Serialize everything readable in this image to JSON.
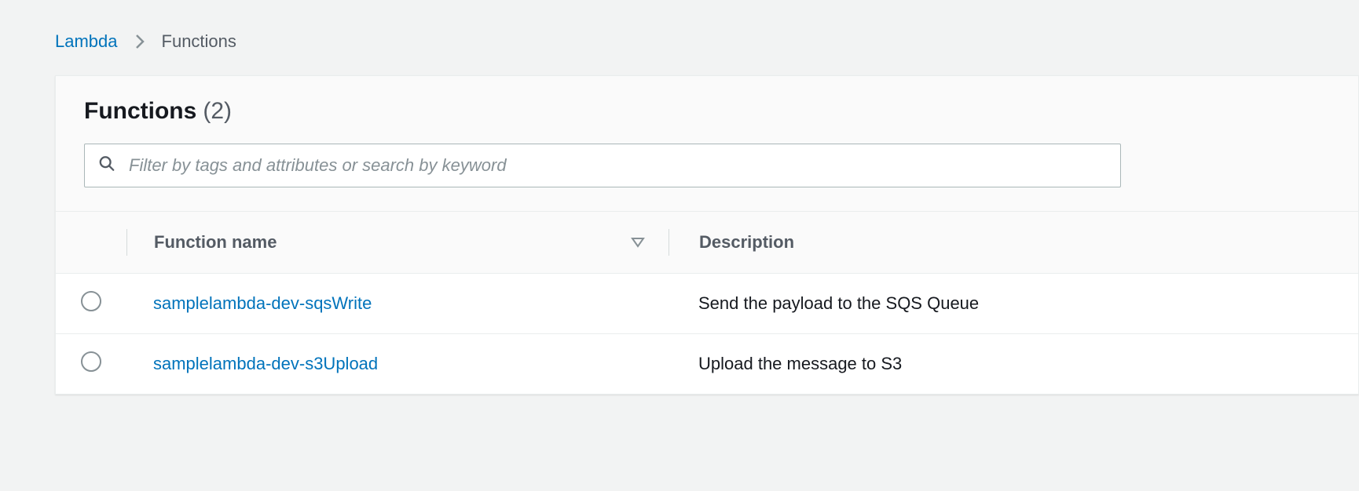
{
  "breadcrumb": {
    "root": "Lambda",
    "current": "Functions"
  },
  "header": {
    "title": "Functions",
    "count_display": "(2)"
  },
  "search": {
    "placeholder": "Filter by tags and attributes or search by keyword"
  },
  "table": {
    "columns": {
      "name": "Function name",
      "description": "Description"
    },
    "rows": [
      {
        "name": "samplelambda-dev-sqsWrite",
        "description": "Send the payload to the SQS Queue"
      },
      {
        "name": "samplelambda-dev-s3Upload",
        "description": "Upload the message to S3"
      }
    ]
  }
}
